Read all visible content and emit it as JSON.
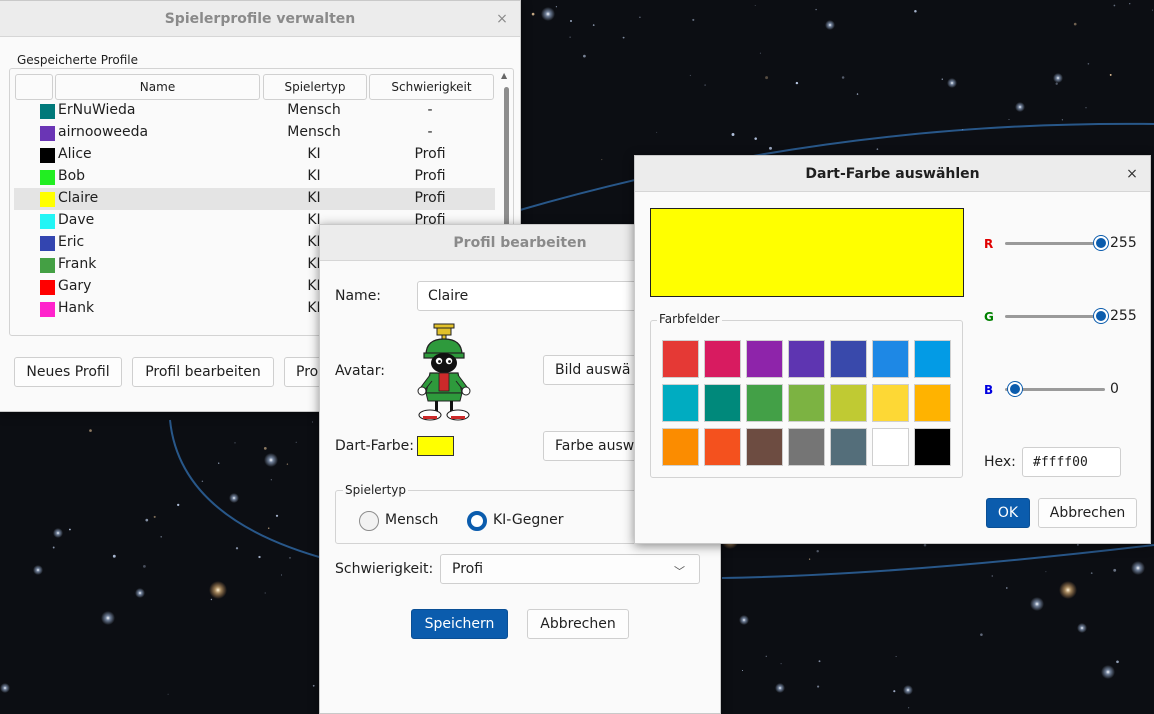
{
  "profiles_window": {
    "title": "Spielerprofile verwalten",
    "group_label": "Gespeicherte Profile",
    "columns": [
      "",
      "Name",
      "Spielertyp",
      "Schwierigkeit"
    ],
    "rows": [
      {
        "color": "#00797a",
        "name": "ErNuWieda",
        "type": "Mensch",
        "difficulty": "-"
      },
      {
        "color": "#6a35b5",
        "name": "airnooweeda",
        "type": "Mensch",
        "difficulty": "-"
      },
      {
        "color": "#000000",
        "name": "Alice",
        "type": "KI",
        "difficulty": "Profi"
      },
      {
        "color": "#22ee22",
        "name": "Bob",
        "type": "KI",
        "difficulty": "Profi"
      },
      {
        "color": "#ffff00",
        "name": "Claire",
        "type": "KI",
        "difficulty": "Profi",
        "selected": true
      },
      {
        "color": "#22f5f5",
        "name": "Dave",
        "type": "KI",
        "difficulty": "Profi"
      },
      {
        "color": "#3345b0",
        "name": "Eric",
        "type": "KI",
        "difficulty": ""
      },
      {
        "color": "#44a044",
        "name": "Frank",
        "type": "KI",
        "difficulty": ""
      },
      {
        "color": "#ff0000",
        "name": "Gary",
        "type": "KI",
        "difficulty": ""
      },
      {
        "color": "#ff22cc",
        "name": "Hank",
        "type": "KI",
        "difficulty": ""
      }
    ],
    "buttons": {
      "new": "Neues Profil",
      "edit": "Profil bearbeiten",
      "third": "Pro"
    },
    "close_glyph": "×"
  },
  "edit_window": {
    "title": "Profil bearbeiten",
    "name_label": "Name:",
    "name_value": "Claire",
    "avatar_label": "Avatar:",
    "choose_image": "Bild auswä",
    "color_label": "Dart-Farbe:",
    "dart_color": "#ffff00",
    "choose_color": "Farbe ausw",
    "player_type_group": "Spielertyp",
    "radio_human": "Mensch",
    "radio_ai": "KI-Gegner",
    "selected_type": "KI-Gegner",
    "difficulty_label": "Schwierigkeit:",
    "difficulty_value": "Profi",
    "save": "Speichern",
    "cancel": "Abbrechen"
  },
  "color_window": {
    "title": "Dart-Farbe auswählen",
    "close_glyph": "×",
    "preview_color": "#ffff00",
    "swatches_label": "Farbfelder",
    "swatches": [
      "#e53935",
      "#d81b60",
      "#8e24aa",
      "#5e35b1",
      "#3949ab",
      "#1e88e5",
      "#039be5",
      "#00acc1",
      "#00897b",
      "#43a047",
      "#7cb342",
      "#c0ca33",
      "#fdd835",
      "#ffb300",
      "#fb8c00",
      "#f4511e",
      "#6d4c41",
      "#757575",
      "#546e7a",
      "#ffffff",
      "#000000"
    ],
    "r_label": "R",
    "g_label": "G",
    "b_label": "B",
    "r": 255,
    "g": 255,
    "b": 0,
    "r_color": "#e00000",
    "g_color": "#008000",
    "b_color": "#0000e0",
    "hex_label": "Hex:",
    "hex_value": "#ffff00",
    "ok": "OK",
    "cancel": "Abbrechen"
  }
}
